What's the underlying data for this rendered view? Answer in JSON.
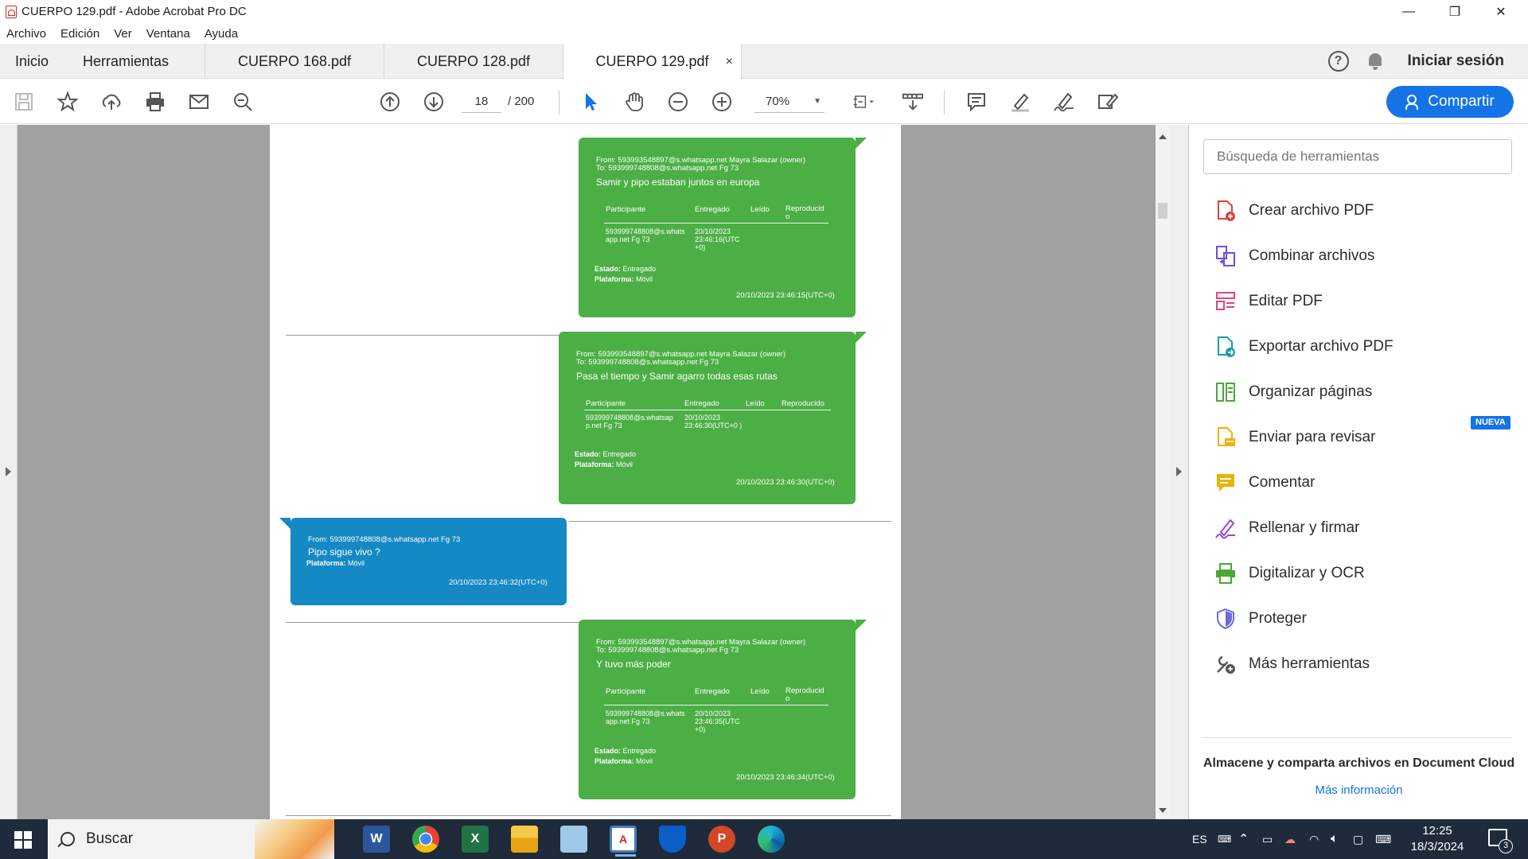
{
  "window": {
    "title": "CUERPO 129.pdf - Adobe Acrobat Pro DC",
    "minimize": "—",
    "restore": "❐",
    "close": "✕"
  },
  "menu": [
    "Archivo",
    "Edición",
    "Ver",
    "Ventana",
    "Ayuda"
  ],
  "tabs": {
    "home": "Inicio",
    "tools": "Herramientas",
    "docs": [
      {
        "label": "CUERPO 168.pdf",
        "active": false
      },
      {
        "label": "CUERPO 128.pdf",
        "active": false
      },
      {
        "label": "CUERPO 129.pdf",
        "active": true
      }
    ],
    "close": "×",
    "help": "?",
    "signin": "Iniciar sesión"
  },
  "toolbar": {
    "icons": [
      "save-icon",
      "star-icon",
      "upload-icon",
      "print-icon",
      "mail-icon",
      "zoom-search-icon",
      "prev-page-icon",
      "next-page-icon",
      "select-cursor-icon",
      "hand-icon",
      "zoom-out-icon",
      "zoom-in-icon",
      "fit-page-icon",
      "scroll-mode-icon",
      "comment-icon",
      "highlight-icon",
      "sign-icon",
      "edit-icon"
    ],
    "page_current": "18",
    "page_total": "/ 200",
    "zoom": "70%",
    "share_label": "Compartir",
    "accent": "#1473e6"
  },
  "messages": [
    {
      "type": "sent",
      "from": "From: 593993548897@s.whatsapp.net Mayra Salazar (owner)",
      "to": "To: 593999748808@s.whatsapp.net Fg 73",
      "body": "Samir y pipo estaban juntos en europa",
      "headers": [
        "Participante",
        "Entregado",
        "Leído",
        "Reproducid o"
      ],
      "participant": "593999748808@s.whats app.net Fg 73",
      "delivered": "20/10/2023 23:46:16(UTC +0)",
      "state_label": "Estado:",
      "state": "Entregado",
      "platform_label": "Plataforma:",
      "platform": "Móvil",
      "timestamp": "20/10/2023 23:46:15(UTC+0)"
    },
    {
      "type": "sent",
      "from": "From: 593993548897@s.whatsapp.net Mayra Salazar (owner)",
      "to": "To: 593999748808@s.whatsapp.net Fg 73",
      "body": "Pasa el tiempo y Samir agarro todas esas rutas",
      "headers": [
        "Participante",
        "Entregado",
        "Leído",
        "Reproducido"
      ],
      "participant": "593999748808@s.whatsap p.net Fg 73",
      "delivered": "20/10/2023 23:46:30(UTC+0 )",
      "state_label": "Estado:",
      "state": "Entregado",
      "platform_label": "Plataforma:",
      "platform": "Móvil",
      "timestamp": "20/10/2023 23:46:30(UTC+0)"
    },
    {
      "type": "received",
      "from": "From: 593999748808@s.whatsapp.net Fg 73",
      "body": "Pipo sigue vivo ?",
      "platform_label": "Plataforma:",
      "platform": "Móvil",
      "timestamp": "20/10/2023 23:46:32(UTC+0)"
    },
    {
      "type": "sent",
      "from": "From: 593993548897@s.whatsapp.net Mayra Salazar (owner)",
      "to": "To: 593999748808@s.whatsapp.net Fg 73",
      "body": "Y tuvo más poder",
      "headers": [
        "Participante",
        "Entregado",
        "Leído",
        "Reproducid o"
      ],
      "participant": "593999748808@s.whats app.net Fg 73",
      "delivered": "20/10/2023 23:46:35(UTC +0)",
      "state_label": "Estado:",
      "state": "Entregado",
      "platform_label": "Plataforma:",
      "platform": "Móvil",
      "timestamp": "20/10/2023 23:46:34(UTC+0)"
    }
  ],
  "bubble_colors": {
    "sent": "#4caf45",
    "received": "#1589c4"
  },
  "right_panel": {
    "search_placeholder": "Búsqueda de herramientas",
    "tools": [
      {
        "label": "Crear archivo PDF",
        "icon": "create-pdf-icon",
        "color": "#e0413a"
      },
      {
        "label": "Combinar archivos",
        "icon": "combine-files-icon",
        "color": "#6c4ee0"
      },
      {
        "label": "Editar PDF",
        "icon": "edit-pdf-icon",
        "color": "#e0457a"
      },
      {
        "label": "Exportar archivo PDF",
        "icon": "export-pdf-icon",
        "color": "#16a0a0"
      },
      {
        "label": "Organizar páginas",
        "icon": "organize-pages-icon",
        "color": "#4aa838"
      },
      {
        "label": "Enviar para revisar",
        "icon": "send-review-icon",
        "color": "#e8b400"
      },
      {
        "label": "Comentar",
        "icon": "comment-tool-icon",
        "color": "#e8b400"
      },
      {
        "label": "Rellenar y firmar",
        "icon": "fill-sign-icon",
        "color": "#9b45d6"
      },
      {
        "label": "Digitalizar y OCR",
        "icon": "scan-ocr-icon",
        "color": "#4aa838"
      },
      {
        "label": "Proteger",
        "icon": "protect-icon",
        "color": "#6c6cd8"
      },
      {
        "label": "Más herramientas",
        "icon": "more-tools-icon",
        "color": "#555555"
      }
    ],
    "new_badge": "NUEVA",
    "cloud_text": "Almacene y comparta archivos en Document Cloud",
    "more_info": "Más información"
  },
  "taskbar": {
    "search": "Buscar",
    "apps": [
      "word-icon",
      "chrome-icon",
      "excel-icon",
      "file-explorer-icon",
      "notepad-icon",
      "acrobat-icon",
      "defender-icon",
      "powerpoint-icon",
      "edge-icon"
    ],
    "lang": "ES",
    "time": "12:25",
    "date": "18/3/2024",
    "notifications": "3"
  }
}
